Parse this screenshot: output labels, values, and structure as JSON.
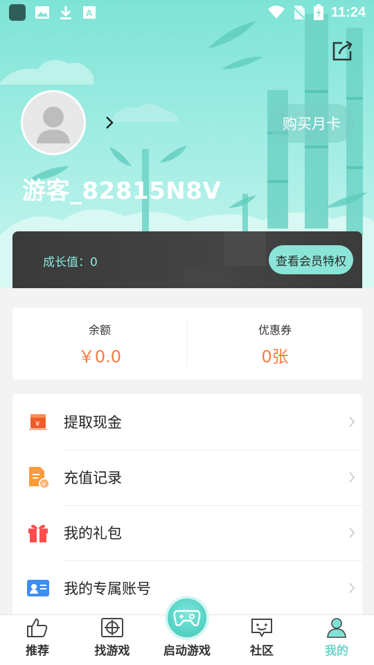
{
  "statusbar": {
    "time": "11:24",
    "left_icons": [
      "app-icon",
      "image-icon",
      "download-icon",
      "font-icon"
    ],
    "right_icons": [
      "wifi-icon",
      "no-sim-icon",
      "battery-charging-icon"
    ]
  },
  "profile": {
    "username": "游客_82815N8V",
    "buy_card_label": "购买月卡"
  },
  "vip": {
    "growth_label": "成长值：0",
    "privilege_button": "查看会员特权"
  },
  "balance": {
    "balance_label": "余额",
    "balance_value": "￥0.0",
    "coupon_label": "优惠券",
    "coupon_value": "0张"
  },
  "menu": [
    {
      "label": "提取现金",
      "icon": "cash-withdraw-icon"
    },
    {
      "label": "充值记录",
      "icon": "recharge-record-icon"
    },
    {
      "label": "我的礼包",
      "icon": "gift-icon"
    },
    {
      "label": "我的专属账号",
      "icon": "account-card-icon"
    }
  ],
  "tabs": [
    {
      "label": "推荐",
      "icon": "thumbs-up-icon"
    },
    {
      "label": "找游戏",
      "icon": "target-icon"
    },
    {
      "label": "启动游戏",
      "icon": "gamepad-icon"
    },
    {
      "label": "社区",
      "icon": "chat-face-icon"
    },
    {
      "label": "我的",
      "icon": "user-icon"
    }
  ],
  "colors": {
    "accent": "#6fd7cb",
    "value_orange": "#ff7a3d",
    "vip_bar": "#3f3f3f"
  }
}
